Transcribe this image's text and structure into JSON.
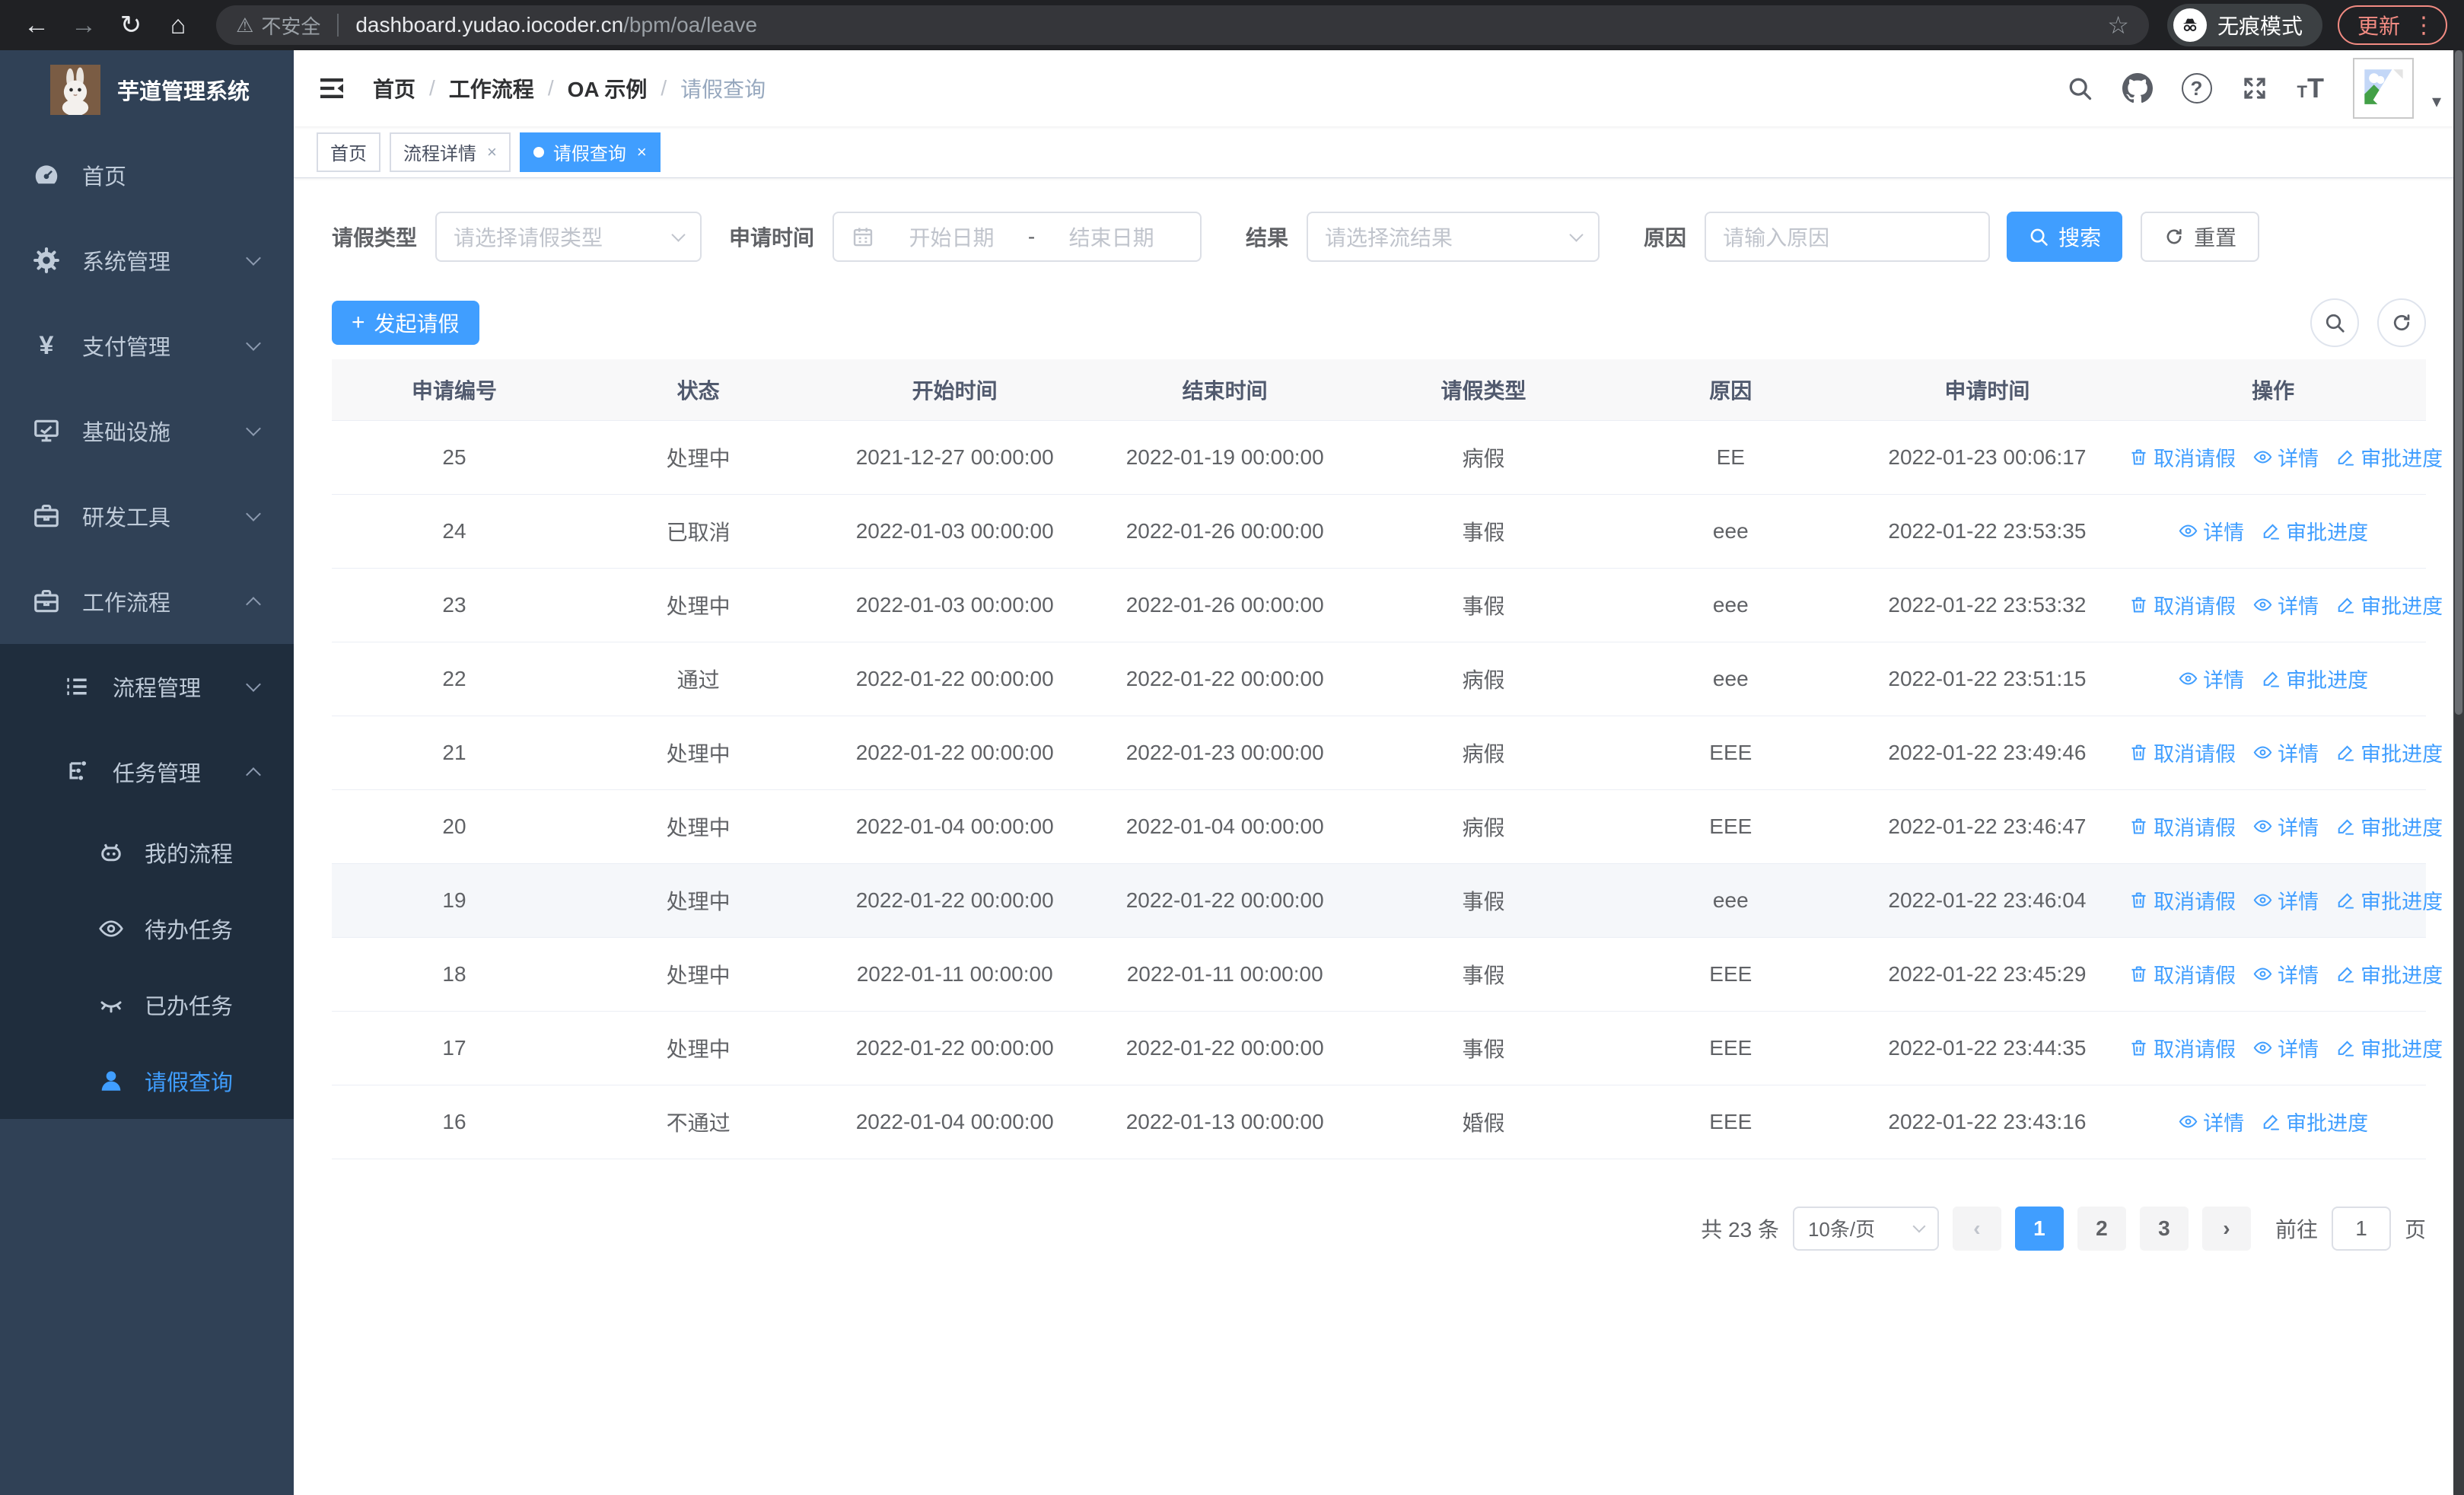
{
  "browser": {
    "security_label": "不安全",
    "url_host": "dashboard.yudao.iocoder.cn",
    "url_path": "/bpm/oa/leave",
    "incognito_label": "无痕模式",
    "update_label": "更新"
  },
  "icons": {
    "back": "←",
    "forward": "→",
    "reload": "↻",
    "home": "⌂",
    "star": "☆",
    "more_vertical": "⋮",
    "caret_down": "▾",
    "plus": "+",
    "yen": "¥",
    "question": "?",
    "font_small": "T",
    "font_large": "T",
    "prev": "‹",
    "next": "›",
    "warning": "⚠"
  },
  "sidebar": {
    "title": "芋道管理系统",
    "items": [
      {
        "label": "首页"
      },
      {
        "label": "系统管理"
      },
      {
        "label": "支付管理"
      },
      {
        "label": "基础设施"
      },
      {
        "label": "研发工具"
      },
      {
        "label": "工作流程"
      }
    ],
    "submenu": [
      {
        "label": "流程管理"
      },
      {
        "label": "任务管理"
      }
    ],
    "tasks": [
      {
        "label": "我的流程"
      },
      {
        "label": "待办任务"
      },
      {
        "label": "已办任务"
      },
      {
        "label": "请假查询"
      }
    ]
  },
  "header": {
    "breadcrumb": [
      "首页",
      "工作流程",
      "OA 示例",
      "请假查询"
    ]
  },
  "tags": [
    {
      "label": "首页"
    },
    {
      "label": "流程详情"
    },
    {
      "label": "请假查询"
    }
  ],
  "filters": {
    "leave_type_label": "请假类型",
    "leave_type_placeholder": "请选择请假类型",
    "apply_time_label": "申请时间",
    "start_date_placeholder": "开始日期",
    "range_separator": "-",
    "end_date_placeholder": "结束日期",
    "result_label": "结果",
    "result_placeholder": "请选择流结果",
    "reason_label": "原因",
    "reason_placeholder": "请输入原因",
    "search_label": "搜索",
    "reset_label": "重置"
  },
  "toolbar": {
    "create_label": "发起请假"
  },
  "table": {
    "columns": [
      "申请编号",
      "状态",
      "开始时间",
      "结束时间",
      "请假类型",
      "原因",
      "申请时间",
      "操作"
    ],
    "rows": [
      {
        "id": "25",
        "status": "处理中",
        "start": "2021-12-27 00:00:00",
        "end": "2022-01-19 00:00:00",
        "type": "病假",
        "reason": "EE",
        "apply": "2022-01-23 00:06:17",
        "actions": [
          "取消请假",
          "详情",
          "审批进度"
        ]
      },
      {
        "id": "24",
        "status": "已取消",
        "start": "2022-01-03 00:00:00",
        "end": "2022-01-26 00:00:00",
        "type": "事假",
        "reason": "eee",
        "apply": "2022-01-22 23:53:35",
        "actions": [
          "详情",
          "审批进度"
        ]
      },
      {
        "id": "23",
        "status": "处理中",
        "start": "2022-01-03 00:00:00",
        "end": "2022-01-26 00:00:00",
        "type": "事假",
        "reason": "eee",
        "apply": "2022-01-22 23:53:32",
        "actions": [
          "取消请假",
          "详情",
          "审批进度"
        ]
      },
      {
        "id": "22",
        "status": "通过",
        "start": "2022-01-22 00:00:00",
        "end": "2022-01-22 00:00:00",
        "type": "病假",
        "reason": "eee",
        "apply": "2022-01-22 23:51:15",
        "actions": [
          "详情",
          "审批进度"
        ]
      },
      {
        "id": "21",
        "status": "处理中",
        "start": "2022-01-22 00:00:00",
        "end": "2022-01-23 00:00:00",
        "type": "病假",
        "reason": "EEE",
        "apply": "2022-01-22 23:49:46",
        "actions": [
          "取消请假",
          "详情",
          "审批进度"
        ]
      },
      {
        "id": "20",
        "status": "处理中",
        "start": "2022-01-04 00:00:00",
        "end": "2022-01-04 00:00:00",
        "type": "病假",
        "reason": "EEE",
        "apply": "2022-01-22 23:46:47",
        "actions": [
          "取消请假",
          "详情",
          "审批进度"
        ]
      },
      {
        "id": "19",
        "status": "处理中",
        "start": "2022-01-22 00:00:00",
        "end": "2022-01-22 00:00:00",
        "type": "事假",
        "reason": "eee",
        "apply": "2022-01-22 23:46:04",
        "actions": [
          "取消请假",
          "详情",
          "审批进度"
        ]
      },
      {
        "id": "18",
        "status": "处理中",
        "start": "2022-01-11 00:00:00",
        "end": "2022-01-11 00:00:00",
        "type": "事假",
        "reason": "EEE",
        "apply": "2022-01-22 23:45:29",
        "actions": [
          "取消请假",
          "详情",
          "审批进度"
        ]
      },
      {
        "id": "17",
        "status": "处理中",
        "start": "2022-01-22 00:00:00",
        "end": "2022-01-22 00:00:00",
        "type": "事假",
        "reason": "EEE",
        "apply": "2022-01-22 23:44:35",
        "actions": [
          "取消请假",
          "详情",
          "审批进度"
        ]
      },
      {
        "id": "16",
        "status": "不通过",
        "start": "2022-01-04 00:00:00",
        "end": "2022-01-13 00:00:00",
        "type": "婚假",
        "reason": "EEE",
        "apply": "2022-01-22 23:43:16",
        "actions": [
          "详情",
          "审批进度"
        ]
      }
    ]
  },
  "pagination": {
    "total_label": "共 23 条",
    "page_size_label": "10条/页",
    "pages": [
      "1",
      "2",
      "3"
    ],
    "active_page": "1",
    "goto_label": "前往",
    "goto_value": "1",
    "page_unit_label": "页"
  },
  "colors": {
    "primary": "#409eff",
    "link": "#409eff",
    "sidebar_bg": "#304156",
    "sidebar_submenu_bg": "#1f2d3d",
    "chrome_bg": "#202124",
    "update_accent": "#f28b82",
    "table_border": "#ebeef5"
  }
}
